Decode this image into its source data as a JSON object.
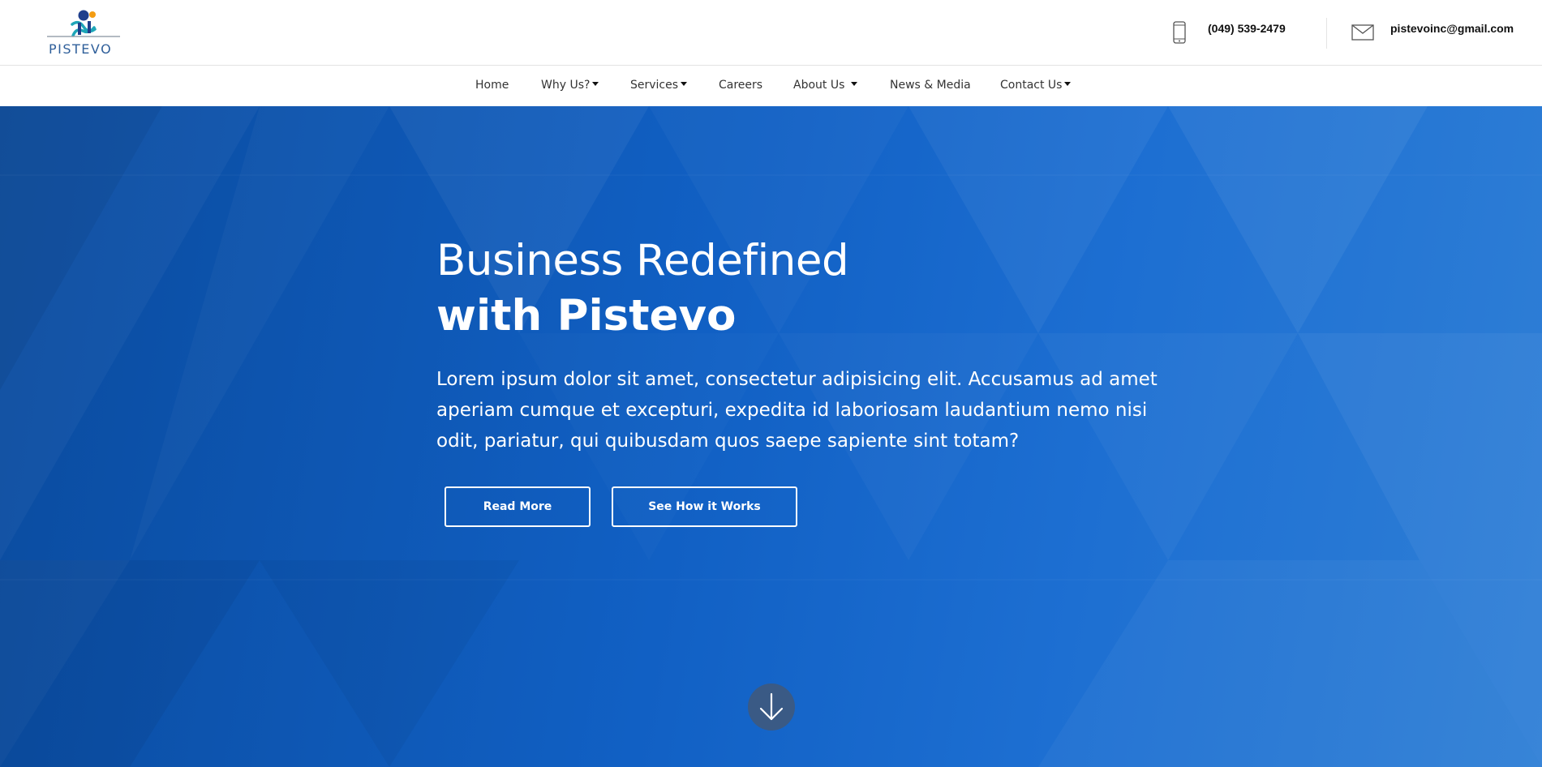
{
  "brand": {
    "logo_text": "PISTEVO",
    "colors": {
      "dark_blue": "#1f3f8c",
      "teal": "#1fa6b8",
      "orange": "#f39c12"
    }
  },
  "contact": {
    "phone": "(049) 539-2479",
    "phone_icon": "mobile-phone-icon",
    "email": "pistevoinc@gmail.com",
    "email_icon": "envelope-icon"
  },
  "nav": {
    "items": [
      {
        "label": "Home",
        "dropdown": false
      },
      {
        "label": "Why Us?",
        "dropdown": true
      },
      {
        "label": "Services",
        "dropdown": true
      },
      {
        "label": "Careers",
        "dropdown": false
      },
      {
        "label": "About Us",
        "dropdown": true
      },
      {
        "label": "News & Media",
        "dropdown": false
      },
      {
        "label": "Contact Us",
        "dropdown": true
      }
    ]
  },
  "hero": {
    "title_line1": "Business Redefined",
    "title_line2": "with Pistevo",
    "lead": "Lorem ipsum dolor sit amet, consectetur adipisicing elit. Accusamus ad amet aperiam cumque et excepturi, expedita id laboriosam laudantium nemo nisi odit, pariatur, qui quibusdam quos saepe sapiente sint totam?",
    "buttons": {
      "read_more": "Read More",
      "see_how": "See How it Works"
    },
    "scroll_icon": "arrow-down-icon",
    "colors": {
      "background_start": "#0a4b9e",
      "background_end": "#2f7fd6",
      "scroll_button": "#3a5a85"
    }
  }
}
